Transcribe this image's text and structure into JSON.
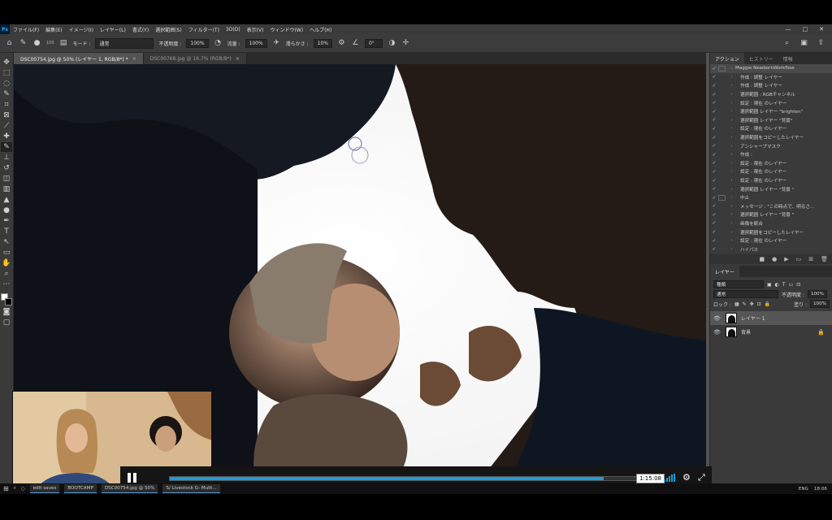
{
  "menu": {
    "app_icon": "Ps",
    "items": [
      "ファイル(F)",
      "編集(E)",
      "イメージ(I)",
      "レイヤー(L)",
      "書式(Y)",
      "選択範囲(S)",
      "フィルター(T)",
      "3D(D)",
      "表示(V)",
      "ウィンドウ(W)",
      "ヘルプ(H)"
    ],
    "window_controls": [
      "—",
      "□",
      "✕"
    ]
  },
  "options": {
    "mode_label": "モード :",
    "mode_value": "通常",
    "opacity_label": "不透明度 :",
    "opacity_value": "100%",
    "flow_label": "流量 :",
    "flow_value": "100%",
    "smoothing_label": "滑らかさ :",
    "smoothing_value": "10%",
    "angle_value": "0°",
    "brush_size": "100"
  },
  "tabs": [
    {
      "label": "DSC00754.jpg @ 50% (レイヤー 1, RGB/8*) *",
      "close": "×"
    },
    {
      "label": "DSC00768.jpg @ 16.7% (RGB/8*)",
      "close": "×"
    }
  ],
  "panels": {
    "actions_tab": "アクション",
    "history_tab": "ヒストリー",
    "info_tab": "情報",
    "actions": [
      "Maggie NewbornWorkflow",
      "作成 : 調整 レイヤー",
      "作成 : 調整 レイヤー",
      "選択範囲 : RGBチャンネル",
      "設定 : 現在 のレイヤー",
      "選択範囲 レイヤー \"brighten\"",
      "選択範囲 レイヤー \"背景\"",
      "設定 : 現在 のレイヤー",
      "選択範囲をコピーしたレイヤー",
      "アンシャープマスク",
      "作成 :",
      "設定 : 現在 のレイヤー",
      "設定 : 現在 のレイヤー",
      "設定 : 現在 のレイヤー",
      "選択範囲 レイヤー \"背景 \"",
      "中止",
      "メッセージ : \"この時点で、明るさ...",
      "選択範囲 レイヤー \"背景 \"",
      "画像を統合",
      "選択範囲をコピーしたレイヤー",
      "設定 : 現在 のレイヤー",
      "ハイパス"
    ],
    "layers_tab": "レイヤー",
    "kind_label": "種類",
    "blend_mode": "通常",
    "opacity_label": "不透明度 :",
    "opacity_value": "100%",
    "lock_label": "ロック :",
    "fill_label": "塗り :",
    "fill_value": "100%",
    "layers": [
      {
        "name": "レイヤー 1"
      },
      {
        "name": "背景"
      }
    ]
  },
  "video": {
    "time": "1:15:08",
    "progress": 0.89
  },
  "taskbar": {
    "apps": [
      "edit saves",
      "BOOTCAMP",
      "DSC00754.jpg @ 50%",
      "S/ Livestock G- Multi..."
    ],
    "tray": [
      "ENG",
      "18:06"
    ]
  }
}
